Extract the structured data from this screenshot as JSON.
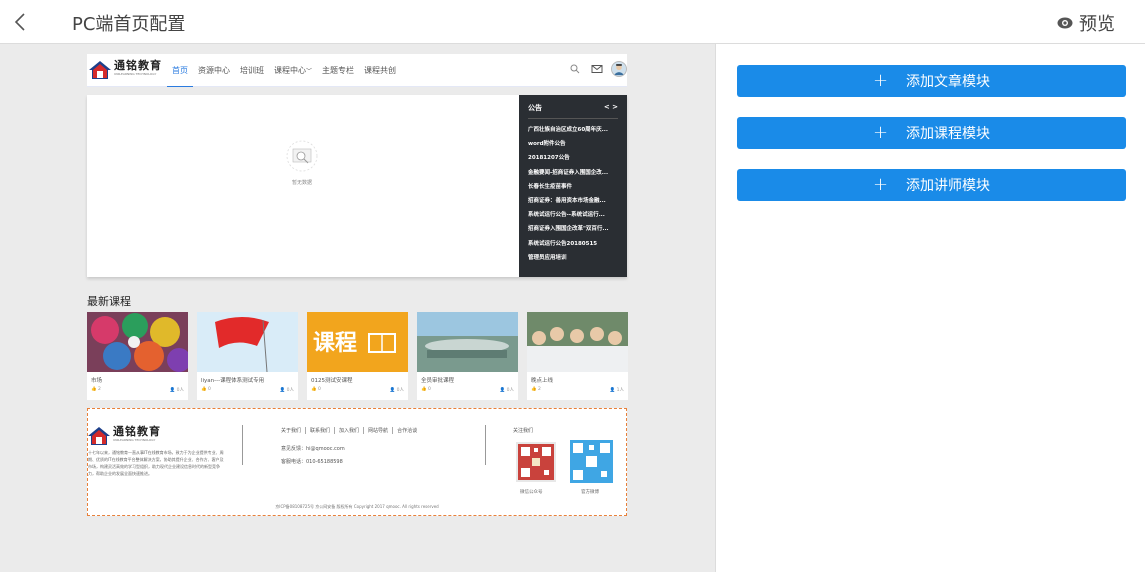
{
  "header": {
    "title": "PC端首页配置",
    "preview_label": "预览"
  },
  "site_preview": {
    "logo": {
      "text": "通铭教育",
      "subtitle": "UNILEARNING TECHNOLOGY"
    },
    "nav_items": [
      {
        "label": "首页",
        "active": true
      },
      {
        "label": "资源中心"
      },
      {
        "label": "培训班"
      },
      {
        "label": "课程中心"
      },
      {
        "label": "主题专栏"
      },
      {
        "label": "课程共创"
      }
    ],
    "banner": {
      "empty_text": "暂无数据"
    },
    "notice": {
      "title": "公告",
      "items": [
        "广西壮族自治区成立60周年庆...",
        "word附件公告",
        "20181207公告",
        "金融要闻-招商证券入围国企改...",
        "长春长生疫苗事件",
        "招商证券：善用资本市场金融...",
        "系统试运行公告--系统试运行...",
        "招商证券入围国企改革\"双百行...",
        "系统试运行公告20180515",
        "管理员应用培训"
      ]
    },
    "latest_courses_title": "最新课程",
    "courses": [
      {
        "name": "市场",
        "likes": "2",
        "learners": "0人"
      },
      {
        "name": "liyan---课程体系测试专用",
        "likes": "0",
        "learners": "0人"
      },
      {
        "name": "0125测试安课程",
        "likes": "0",
        "learners": "0人"
      },
      {
        "name": "全员审批课程",
        "likes": "0",
        "learners": "0人"
      },
      {
        "name": "晚点上线",
        "likes": "2",
        "learners": "1人"
      }
    ],
    "course3_thumb_text": "课程",
    "footer": {
      "description": "十七年以来，通铭教育一直从事IT在线教育市场，致力于为企业提供专业、周期、优质的IT在线教育平台整体解决方案，协助其提升企业、合作方、客户及市场，构建灵活高效的学习型组织，助力现代企业建设信息时代的新型竞争力，帮助企业的发展全面快速推进。",
      "links": [
        "关于我们",
        "联系我们",
        "加入我们",
        "网站导航",
        "合作洽谈"
      ],
      "feedback": "意见反馈：hi@qmooc.com",
      "phone": "客服电话：010-65188598",
      "follow_title": "关注我们",
      "qr1_label": "微信公众号",
      "qr2_label": "官方微博",
      "copyright": "京ICP备08108725号 京公网安备 版权所有 Copyright 2017 qmooc. All rights reserved"
    }
  },
  "panel": {
    "buttons": [
      {
        "label": "添加文章模块"
      },
      {
        "label": "添加课程模块"
      },
      {
        "label": "添加讲师模块"
      }
    ]
  },
  "colors": {
    "accent": "#1a8be8",
    "notice_bg": "#2a2e33",
    "footer_border": "#e8803a"
  }
}
